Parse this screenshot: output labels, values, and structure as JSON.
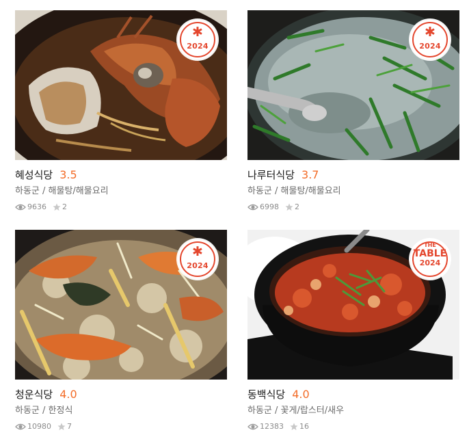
{
  "restaurants": [
    {
      "name": "혜성식당",
      "rating": "3.5",
      "location": "하동군",
      "category": "해물탕/해물요리",
      "views": "9636",
      "reviews": "2",
      "badge": {
        "star": "✱",
        "year": "2024"
      },
      "photo_icon": "crab-stew-photo"
    },
    {
      "name": "나루터식당",
      "rating": "3.7",
      "location": "하동군",
      "category": "해물탕/해물요리",
      "views": "6998",
      "reviews": "2",
      "badge": {
        "star": "✱",
        "year": "2024"
      },
      "photo_icon": "clam-soup-photo"
    },
    {
      "name": "청운식당",
      "rating": "4.0",
      "location": "하동군",
      "category": "한정식",
      "views": "10980",
      "reviews": "7",
      "badge": {
        "star": "✱",
        "year": "2024"
      },
      "photo_icon": "bibimbap-photo"
    },
    {
      "name": "동백식당",
      "rating": "4.0",
      "location": "하동군",
      "category": "꽃게/랍스터/새우",
      "views": "12383",
      "reviews": "16",
      "badge": {
        "line1": "THE",
        "line2": "TABLE",
        "line3": "2024"
      },
      "photo_icon": "stew-pot-photo"
    }
  ],
  "separator": " / ",
  "colors": {
    "accent": "#e4462d",
    "rating": "#f36b26",
    "meta": "#6a6a6a",
    "stat": "#8c8c8c"
  }
}
